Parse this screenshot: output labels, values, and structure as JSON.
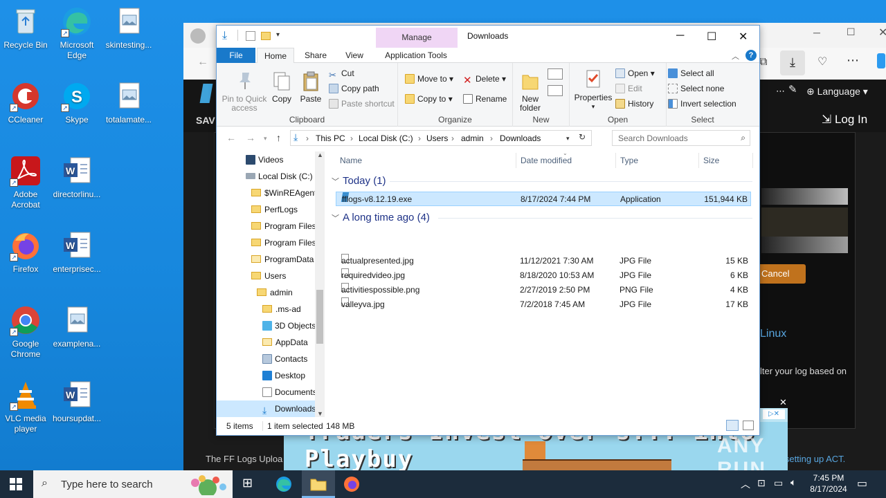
{
  "desktop": {
    "icons_col1": [
      {
        "label": "Recycle Bin"
      },
      {
        "label": "CCleaner"
      },
      {
        "label": "Adobe Acrobat"
      },
      {
        "label": "Firefox"
      },
      {
        "label": "Google Chrome"
      },
      {
        "label": "VLC media player"
      }
    ],
    "icons_col2": [
      {
        "label": "Microsoft Edge"
      },
      {
        "label": "Skype"
      },
      {
        "label": "directorlinu..."
      },
      {
        "label": "enterprisec..."
      },
      {
        "label": "examplena..."
      },
      {
        "label": "hoursupdat..."
      }
    ],
    "icons_col3": [
      {
        "label": "skintesting..."
      },
      {
        "label": "totalamate..."
      }
    ]
  },
  "browser": {
    "language_label": "Language",
    "login_label": "Log In",
    "cancel_label": "Cancel",
    "linux_text": "Linux",
    "log_text": "lter your log based on",
    "footer_text": "The FF Logs Uploa",
    "act_text": "n setting up ACT.",
    "ad_text": "Traders Invest over s... into Playbuy",
    "watermark": "ANY RUN"
  },
  "explorer": {
    "title": "Downloads",
    "manage_label": "Manage",
    "tabs": {
      "file": "File",
      "home": "Home",
      "share": "Share",
      "view": "View",
      "app_tools": "Application Tools"
    },
    "ribbon": {
      "pin": "Pin to Quick access",
      "copy": "Copy",
      "paste": "Paste",
      "cut": "Cut",
      "copy_path": "Copy path",
      "paste_shortcut": "Paste shortcut",
      "clipboard": "Clipboard",
      "move_to": "Move to",
      "copy_to": "Copy to",
      "delete": "Delete",
      "rename": "Rename",
      "organize": "Organize",
      "new_folder": "New folder",
      "new": "New",
      "properties": "Properties",
      "open": "Open",
      "edit": "Edit",
      "history": "History",
      "open_group": "Open",
      "select_all": "Select all",
      "select_none": "Select none",
      "invert_selection": "Invert selection",
      "select": "Select"
    },
    "breadcrumb": [
      "This PC",
      "Local Disk (C:)",
      "Users",
      "admin",
      "Downloads"
    ],
    "search_placeholder": "Search Downloads",
    "nav": [
      {
        "label": "Videos",
        "indent": 0
      },
      {
        "label": "Local Disk (C:)",
        "indent": 0
      },
      {
        "label": "$WinREAgent",
        "indent": 1
      },
      {
        "label": "PerfLogs",
        "indent": 1
      },
      {
        "label": "Program Files",
        "indent": 1
      },
      {
        "label": "Program Files",
        "indent": 1
      },
      {
        "label": "ProgramData",
        "indent": 1
      },
      {
        "label": "Users",
        "indent": 1
      },
      {
        "label": "admin",
        "indent": 2
      },
      {
        "label": ".ms-ad",
        "indent": 3
      },
      {
        "label": "3D Objects",
        "indent": 3
      },
      {
        "label": "AppData",
        "indent": 3
      },
      {
        "label": "Contacts",
        "indent": 3
      },
      {
        "label": "Desktop",
        "indent": 3
      },
      {
        "label": "Documents",
        "indent": 3
      },
      {
        "label": "Downloads",
        "indent": 3
      }
    ],
    "columns": {
      "name": "Name",
      "date": "Date modified",
      "type": "Type",
      "size": "Size"
    },
    "groups": [
      {
        "header": "Today (1)",
        "files": [
          {
            "name": "fflogs-v8.12.19.exe",
            "date": "8/17/2024 7:44 PM",
            "type": "Application",
            "size": "151,944 KB",
            "selected": true
          }
        ]
      },
      {
        "header": "A long time ago (4)",
        "files": [
          {
            "name": "actualpresented.jpg",
            "date": "11/12/2021 7:30 AM",
            "type": "JPG File",
            "size": "15 KB"
          },
          {
            "name": "requiredvideo.jpg",
            "date": "8/18/2020 10:53 AM",
            "type": "JPG File",
            "size": "6 KB"
          },
          {
            "name": "activitiespossible.png",
            "date": "2/27/2019 2:50 PM",
            "type": "PNG File",
            "size": "4 KB"
          },
          {
            "name": "valleyva.jpg",
            "date": "7/2/2018 7:45 AM",
            "type": "JPG File",
            "size": "17 KB"
          }
        ]
      }
    ],
    "status": {
      "items": "5 items",
      "selected": "1 item selected",
      "size": "148 MB"
    }
  },
  "taskbar": {
    "search_placeholder": "Type here to search",
    "time": "7:45 PM",
    "date": "8/17/2024"
  }
}
